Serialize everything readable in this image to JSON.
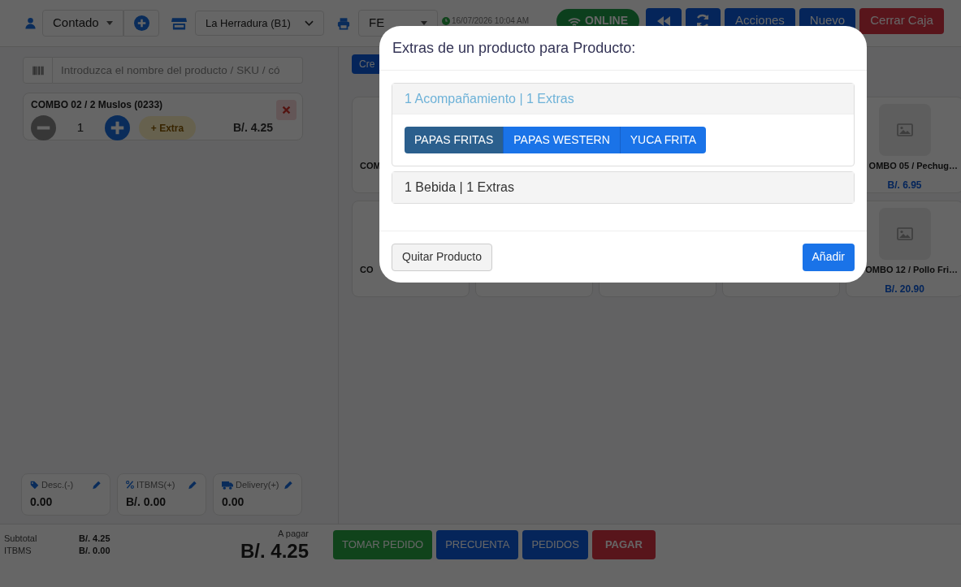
{
  "top_bar": {
    "customer_select": "Contado",
    "branch_select": "La Herradura (B1)",
    "document_select": "FE",
    "datetime": "16/07/2026 10:04 AM",
    "status": "ONLINE",
    "buttons": [
      {
        "label": "Acciones",
        "kind": "primary"
      },
      {
        "label": "Nuevo",
        "kind": "primary"
      },
      {
        "label": "Cerrar Caja",
        "kind": "danger"
      }
    ]
  },
  "search": {
    "placeholder": "Introduzca el nombre del producto / SKU / có"
  },
  "cart_items": [
    {
      "name": "COMBO 02 / 2 Muslos (0233)",
      "quantity": "1",
      "extra_label": "+ Extra",
      "price": "B/. 4.25"
    }
  ],
  "adjustments": [
    {
      "kind": "tag",
      "label": "Desc.(-)",
      "value": "0.00"
    },
    {
      "kind": "percent",
      "label": "ITBMS(+)",
      "value": "B/. 0.00"
    },
    {
      "kind": "truck",
      "label": "Delivery(+)",
      "value": "0.00"
    }
  ],
  "totals": {
    "rows": [
      {
        "label": "Subtotal",
        "value": "B/. 4.25"
      },
      {
        "label": "ITBMS",
        "value": "B/. 0.00"
      }
    ],
    "due_label": "A pagar",
    "due_value": "B/. 4.25"
  },
  "actions": [
    {
      "label": "TOMAR PEDIDO",
      "kind": "success"
    },
    {
      "label": "PRECUENTA",
      "kind": "primary"
    },
    {
      "label": "PEDIDOS",
      "kind": "primary"
    },
    {
      "label": "PAGAR",
      "kind": "danger"
    }
  ],
  "products": {
    "create_button": "Cre",
    "rows": [
      {
        "cards": [
          {
            "kind": "covered",
            "name": "COM"
          },
          {
            "kind": "with_image",
            "name": "OMBO 05 / Pechug…",
            "price": "B/. 6.95"
          }
        ]
      },
      {
        "cards": [
          {
            "kind": "covered",
            "name": "CO"
          },
          {
            "kind": "covered"
          },
          {
            "kind": "covered"
          },
          {
            "kind": "covered"
          },
          {
            "kind": "with_image",
            "name": "OMBO 12 / Pollo Fri…",
            "price": "B/. 20.90"
          }
        ]
      }
    ]
  },
  "modal": {
    "title": "Extras de un producto para Producto:",
    "groups": [
      {
        "title": "1 Acompañamiento | 1 Extras",
        "expanded": true,
        "options": [
          {
            "label": "PAPAS FRITAS",
            "selected": true
          },
          {
            "label": "PAPAS WESTERN",
            "selected": false
          },
          {
            "label": "YUCA FRITA",
            "selected": false
          }
        ]
      },
      {
        "title": "1 Bebida | 1 Extras",
        "expanded": false
      }
    ],
    "buttons": [
      {
        "label": "Quitar Producto",
        "kind": "secondary"
      },
      {
        "label": "Añadir",
        "kind": "primary"
      }
    ]
  }
}
